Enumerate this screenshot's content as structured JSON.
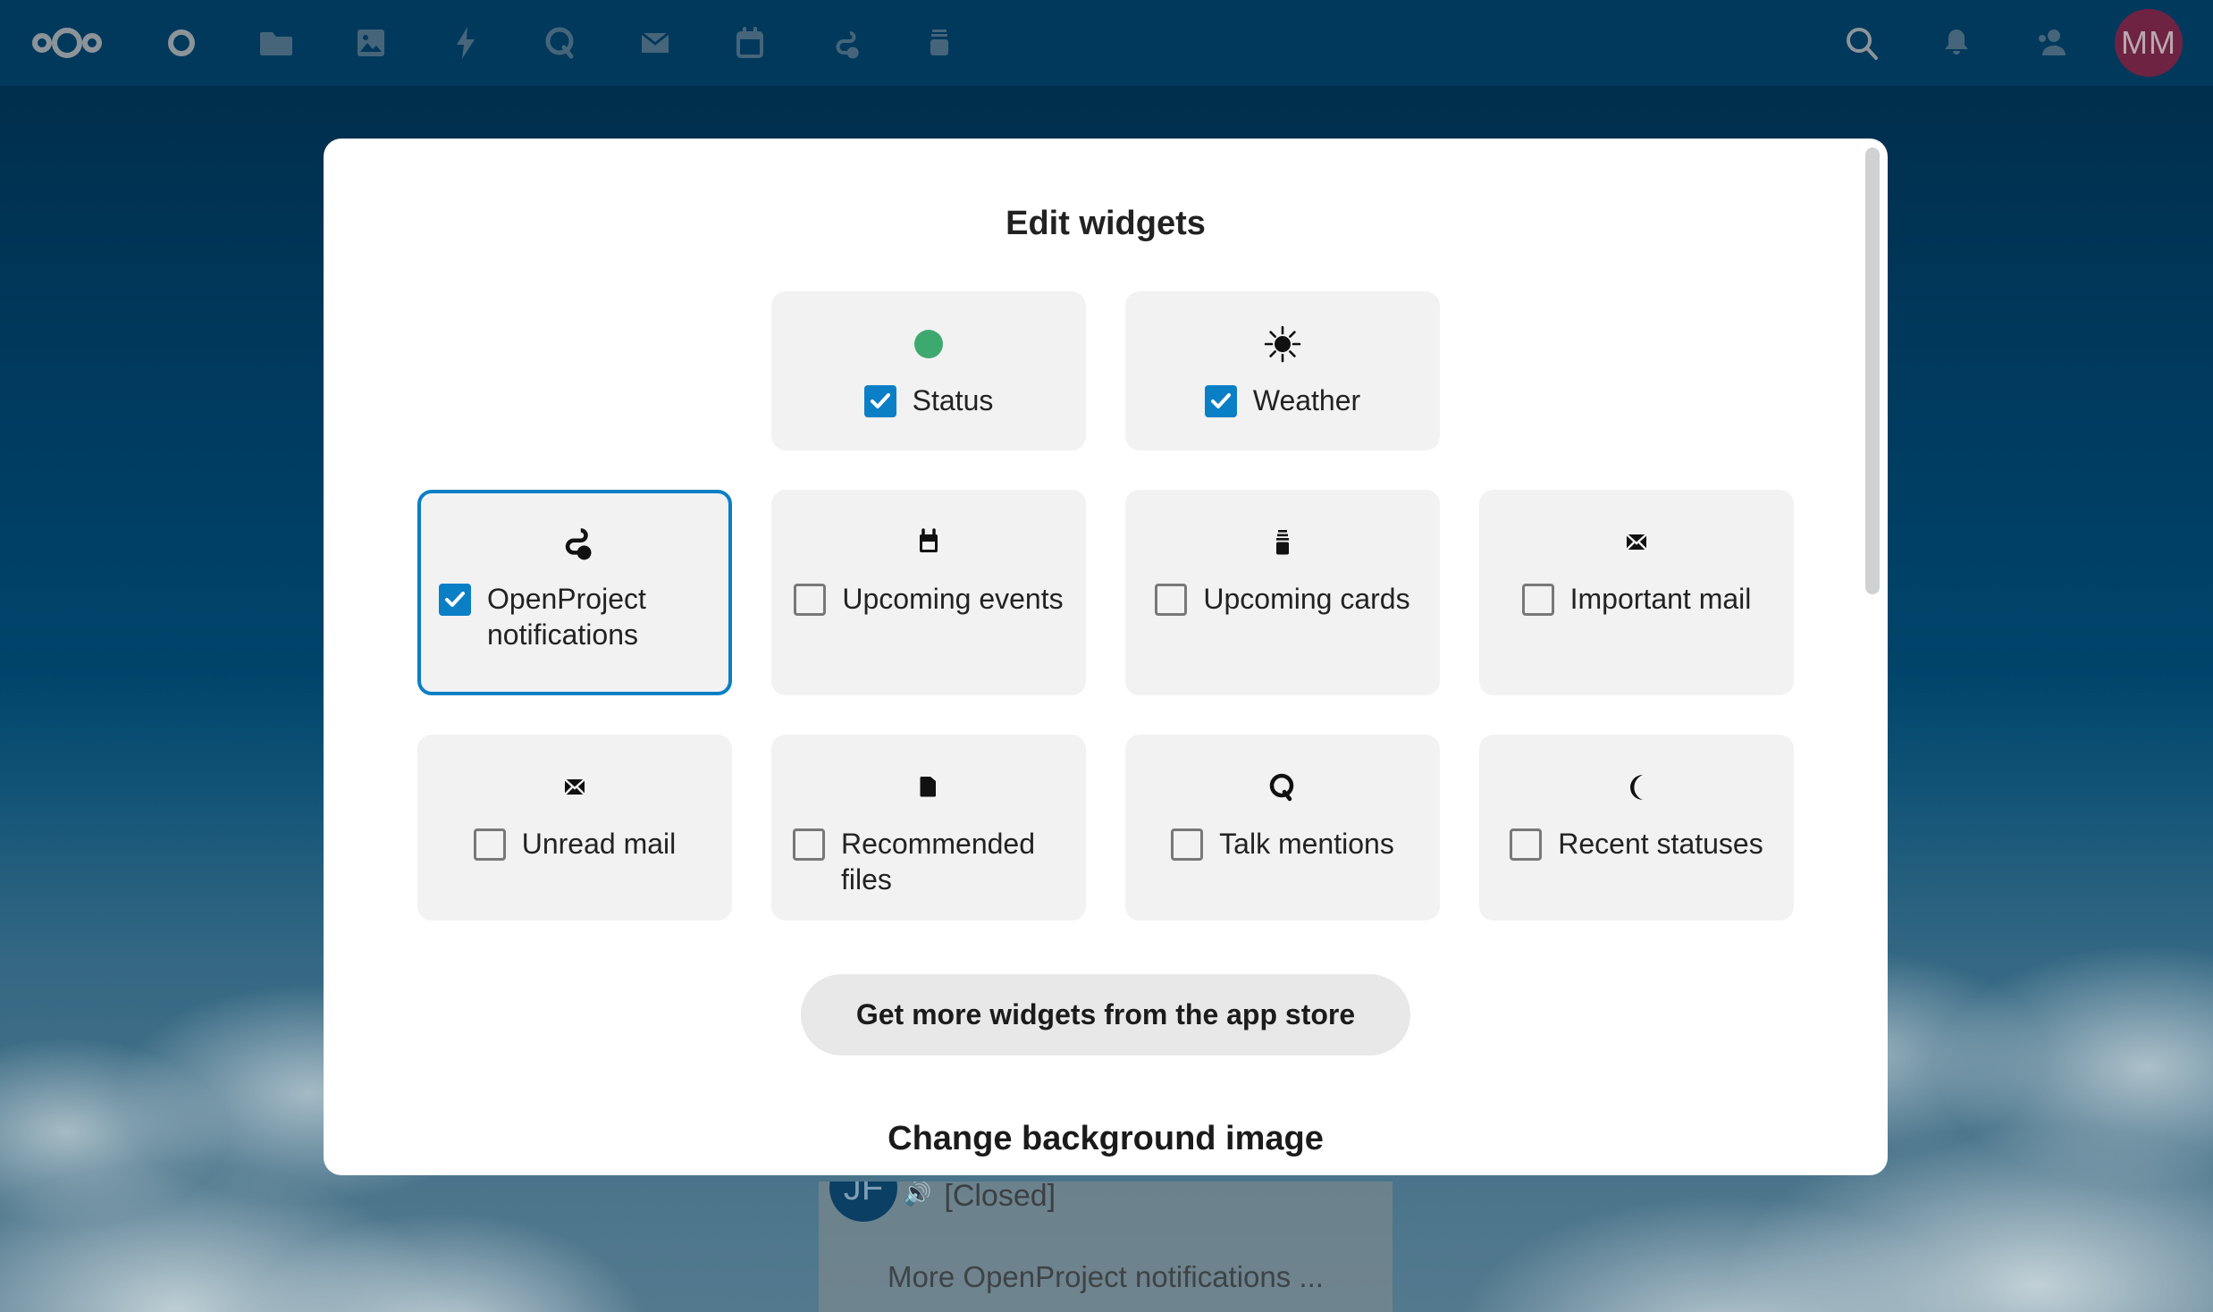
{
  "topbar": {
    "logo_label": "Nextcloud",
    "nav_items": [
      {
        "name": "dashboard",
        "icon": "dashboard-circle-icon"
      },
      {
        "name": "files",
        "icon": "folder-icon"
      },
      {
        "name": "photos",
        "icon": "photos-icon"
      },
      {
        "name": "activity",
        "icon": "lightning-icon"
      },
      {
        "name": "talk",
        "icon": "talk-icon"
      },
      {
        "name": "mail",
        "icon": "mail-icon"
      },
      {
        "name": "calendar",
        "icon": "calendar-icon"
      },
      {
        "name": "openproject",
        "icon": "openproject-icon"
      },
      {
        "name": "deck",
        "icon": "deck-icon"
      }
    ],
    "right_items": [
      {
        "name": "search",
        "icon": "search-icon"
      },
      {
        "name": "notifications",
        "icon": "bell-icon"
      },
      {
        "name": "contacts",
        "icon": "contacts-icon"
      }
    ],
    "avatar_initials": "MM",
    "avatar_color": "#6e2343",
    "background_color": "#00395c"
  },
  "modal": {
    "title": "Edit widgets",
    "app_store_button": "Get more widgets from the app store",
    "background_image_heading": "Change background image",
    "accent_checked_color": "#0b7fc6",
    "card_background_color": "#f2f2f2",
    "focus_border_color": "#0b7fc6",
    "rows": [
      {
        "cards": [
          {
            "label": "Status",
            "checked": true,
            "icon": "green-dot-icon",
            "focused": false
          },
          {
            "label": "Weather",
            "checked": true,
            "icon": "sun-icon",
            "focused": false
          }
        ]
      },
      {
        "cards": [
          {
            "label": "OpenProject notifications",
            "checked": true,
            "icon": "openproject-icon",
            "focused": true
          },
          {
            "label": "Upcoming events",
            "checked": false,
            "icon": "calendar-icon",
            "focused": false
          },
          {
            "label": "Upcoming cards",
            "checked": false,
            "icon": "deck-icon",
            "focused": false
          },
          {
            "label": "Important mail",
            "checked": false,
            "icon": "mail-icon",
            "focused": false
          }
        ]
      },
      {
        "cards": [
          {
            "label": "Unread mail",
            "checked": false,
            "icon": "mail-icon",
            "focused": false
          },
          {
            "label": "Recommended files",
            "checked": false,
            "icon": "folder-icon",
            "focused": false
          },
          {
            "label": "Talk mentions",
            "checked": false,
            "icon": "talk-icon",
            "focused": false
          },
          {
            "label": "Recent statuses",
            "checked": false,
            "icon": "moon-icon",
            "focused": false
          }
        ]
      }
    ]
  },
  "background_widget": {
    "avatar_initials": "JF",
    "status_text": "[Closed]",
    "more_link": "More OpenProject notifications ..."
  }
}
